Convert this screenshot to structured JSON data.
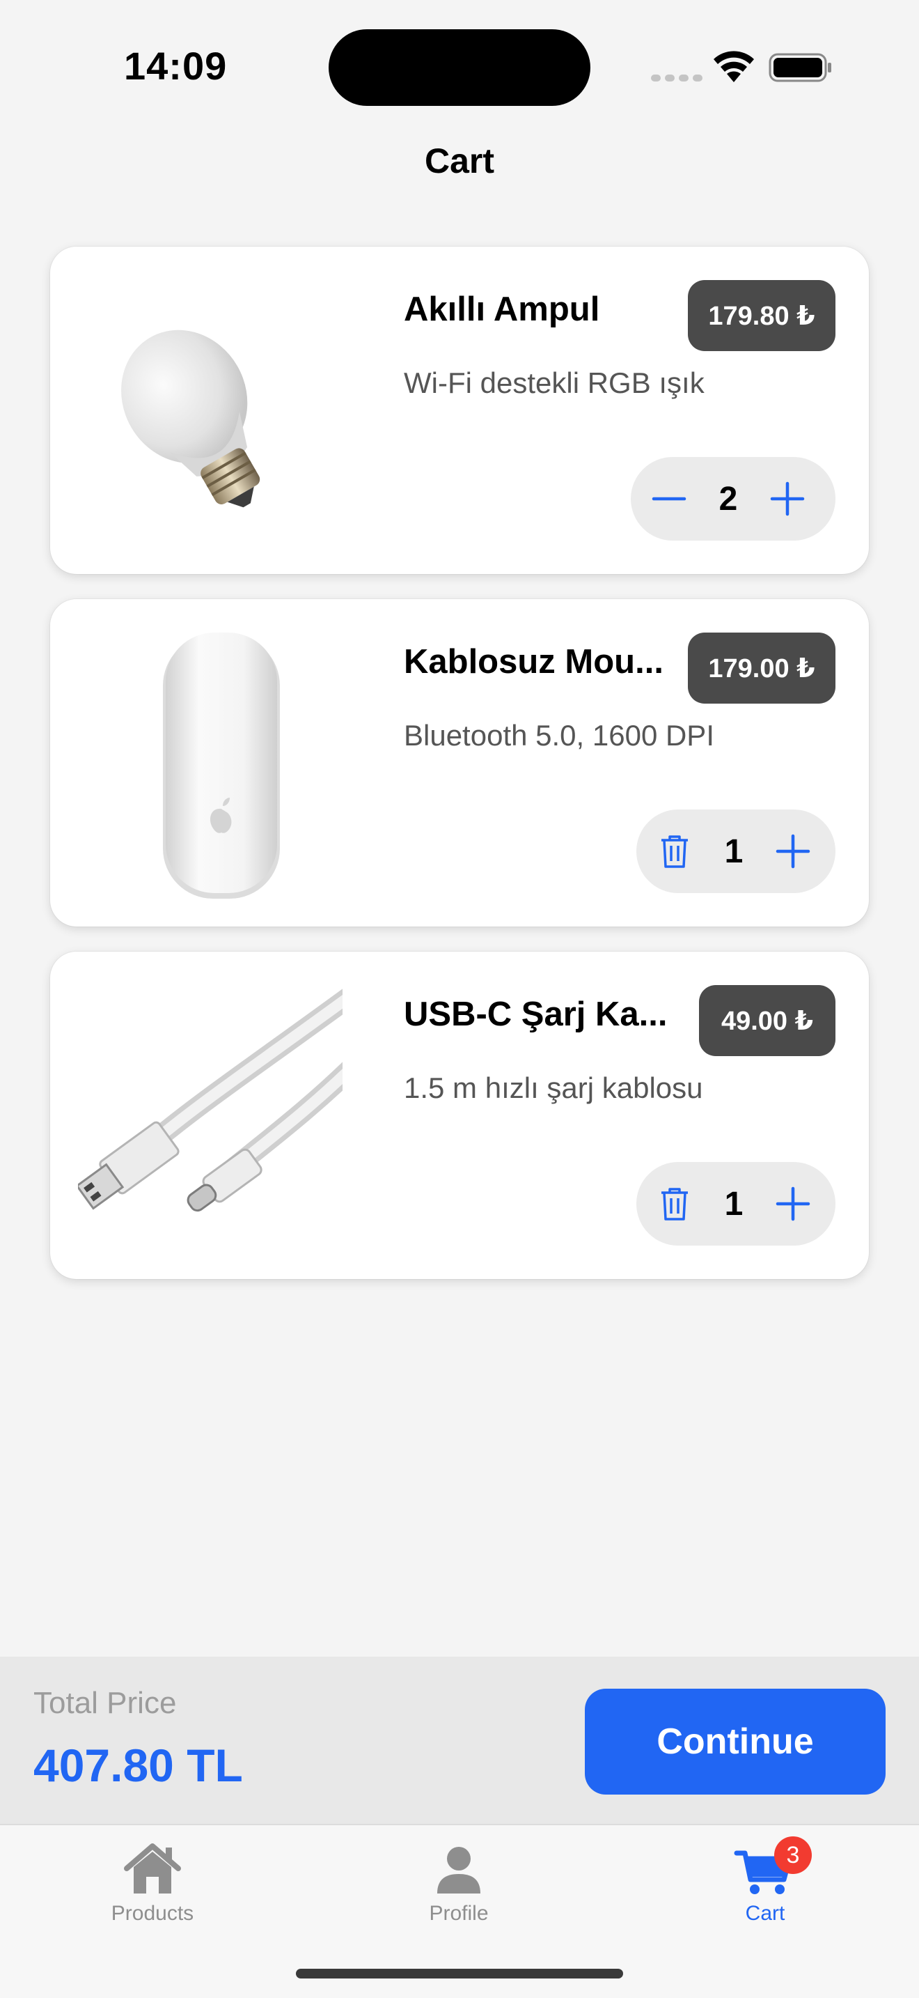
{
  "status_bar": {
    "time": "14:09"
  },
  "header": {
    "title": "Cart"
  },
  "cart": {
    "items": [
      {
        "name": "Akıllı Ampul",
        "price": "179.80 ₺",
        "description": "Wi-Fi destekli RGB ışık",
        "quantity": "2",
        "left_action_icon": "minus-icon",
        "image_icon": "light-bulb"
      },
      {
        "name": "Kablosuz Mou...",
        "price": "179.00 ₺",
        "description": "Bluetooth 5.0, 1600 DPI",
        "quantity": "1",
        "left_action_icon": "trash-icon",
        "image_icon": "wireless-mouse"
      },
      {
        "name": "USB-C Şarj Ka...",
        "price": "49.00 ₺",
        "description": "1.5 m hızlı şarj kablosu",
        "quantity": "1",
        "left_action_icon": "trash-icon",
        "image_icon": "usb-c-cable"
      }
    ]
  },
  "total": {
    "label": "Total Price",
    "value": "407.80 TL"
  },
  "continue_label": "Continue",
  "tabs": [
    {
      "label": "Products",
      "icon": "house-icon"
    },
    {
      "label": "Profile",
      "icon": "person-icon"
    },
    {
      "label": "Cart",
      "icon": "cart-icon",
      "badge": "3",
      "active": true
    }
  ],
  "colors": {
    "accent": "#2166f3",
    "price_badge": "#4a4a4a",
    "notification": "#f23b30"
  }
}
